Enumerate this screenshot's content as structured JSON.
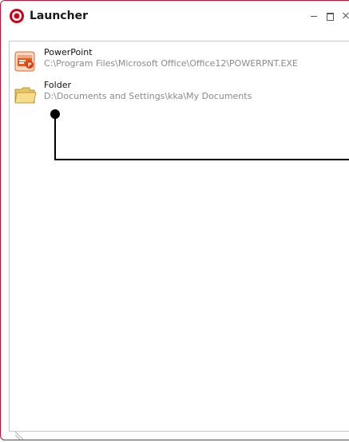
{
  "window": {
    "title": "Launcher",
    "accent_color": "#c8102e",
    "controls": [
      "minimize-icon",
      "maximize-icon",
      "close-icon"
    ]
  },
  "items": [
    {
      "name": "PowerPoint",
      "path": "C:\\Program Files\\Microsoft Office\\Office12\\POWERPNT.EXE",
      "icon": "powerpoint-icon"
    },
    {
      "name": "Folder",
      "path": "D:\\Documents and Settings\\kka\\My Documents",
      "icon": "folder-icon"
    }
  ],
  "annotation": {
    "color": "#000000"
  }
}
